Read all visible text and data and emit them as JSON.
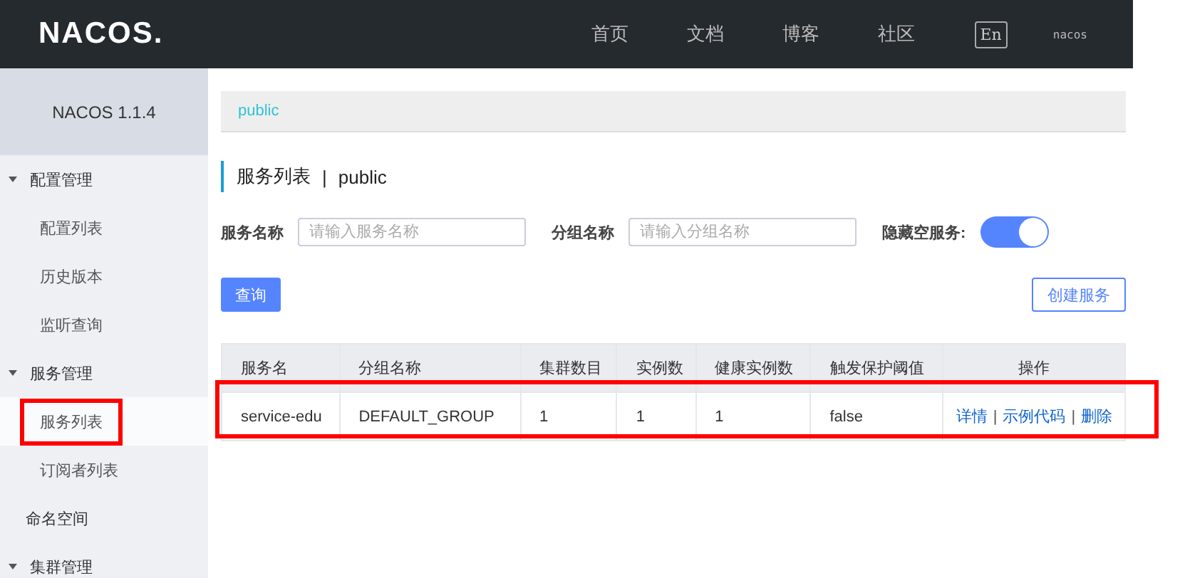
{
  "topbar": {
    "logo": "NACOS.",
    "nav": [
      "首页",
      "文档",
      "博客",
      "社区"
    ],
    "language": "En",
    "user": "nacos"
  },
  "sidebar": {
    "title": "NACOS 1.1.4",
    "items": [
      {
        "label": "配置管理",
        "expanded": true,
        "children": [
          {
            "label": "配置列表",
            "selected": false,
            "highlighted": false
          },
          {
            "label": "历史版本",
            "selected": false,
            "highlighted": false
          },
          {
            "label": "监听查询",
            "selected": false,
            "highlighted": false
          }
        ]
      },
      {
        "label": "服务管理",
        "expanded": true,
        "children": [
          {
            "label": "服务列表",
            "selected": true,
            "highlighted": true
          },
          {
            "label": "订阅者列表",
            "selected": false,
            "highlighted": false
          }
        ]
      },
      {
        "label": "命名空间"
      },
      {
        "label": "集群管理",
        "expanded": true
      }
    ]
  },
  "breadcrumb": "public",
  "page_title": {
    "title": "服务列表",
    "separator": "|",
    "namespace": "public"
  },
  "filters": [
    {
      "label": "服务名称",
      "placeholder": "请输入服务名称"
    },
    {
      "label": "分组名称",
      "placeholder": "请输入分组名称"
    }
  ],
  "hide_empty": {
    "label": "隐藏空服务:",
    "on": true
  },
  "buttons": {
    "query": "查询",
    "create": "创建服务"
  },
  "table": {
    "columns": [
      "服务名",
      "分组名称",
      "集群数目",
      "实例数",
      "健康实例数",
      "触发保护阈值",
      "操作"
    ],
    "rows": [
      {
        "cells": [
          "service-edu",
          "DEFAULT_GROUP",
          "1",
          "1",
          "1",
          "false"
        ],
        "actions": [
          "详情",
          "示例代码",
          "删除"
        ],
        "action_separators": [
          "|",
          "|"
        ],
        "highlighted": true
      }
    ]
  }
}
